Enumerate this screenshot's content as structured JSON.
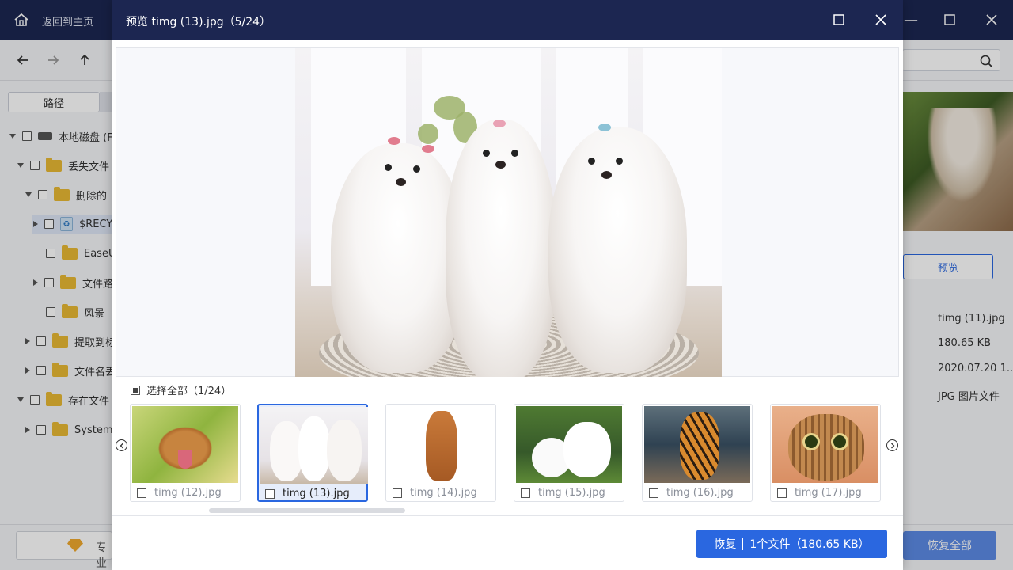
{
  "app": {
    "home_label": "返回到主页",
    "path_tab": "路径",
    "tree": [
      {
        "label": "本地磁盘 (F",
        "icon": "disk-icon",
        "expand": "down"
      },
      {
        "label": "丢失文件",
        "icon": "folder-lost-icon",
        "expand": "down"
      },
      {
        "label": "删除的",
        "icon": "folder-deleted-icon",
        "expand": "down"
      },
      {
        "label": "$RECY",
        "icon": "recycle-bin-icon",
        "expand": "right"
      },
      {
        "label": "EaseU",
        "icon": "folder-icon",
        "expand": "none"
      },
      {
        "label": "文件路",
        "icon": "folder-icon",
        "expand": "right"
      },
      {
        "label": "风景",
        "icon": "folder-icon",
        "expand": "none"
      },
      {
        "label": "提取到标",
        "icon": "folder-extract-icon",
        "expand": "right"
      },
      {
        "label": "文件名丢",
        "icon": "folder-lostname-icon",
        "expand": "right"
      },
      {
        "label": "存在文件",
        "icon": "folder-icon",
        "expand": "down"
      },
      {
        "label": "System",
        "icon": "folder-icon",
        "expand": "right"
      }
    ],
    "right_panel": {
      "preview_button": "预览",
      "file_name": "timg (11).jpg",
      "file_size": "180.65 KB",
      "file_date": "2020.07.20 1...",
      "file_type": "JPG 图片文件"
    },
    "bottom": {
      "upgrade_label": "专业",
      "recover_all": "恢复全部"
    }
  },
  "modal": {
    "title": "预览 timg (13).jpg（5/24）",
    "select_all_label": "选择全部（1/24）",
    "thumbnails": [
      {
        "label": "timg (12).jpg",
        "subject": "dog"
      },
      {
        "label": "timg (13).jpg",
        "subject": "maltese"
      },
      {
        "label": "timg (14).jpg",
        "subject": "puppy"
      },
      {
        "label": "timg (15).jpg",
        "subject": "samoyed"
      },
      {
        "label": "timg (16).jpg",
        "subject": "tiger"
      },
      {
        "label": "timg (17).jpg",
        "subject": "cat"
      }
    ],
    "active_index": 1,
    "recover_label": "恢复",
    "recover_count": "1个文件（180.65 KB）"
  },
  "colors": {
    "titlebar": "#1c2651",
    "accent": "#2a67e0",
    "folder": "#e8b934"
  }
}
